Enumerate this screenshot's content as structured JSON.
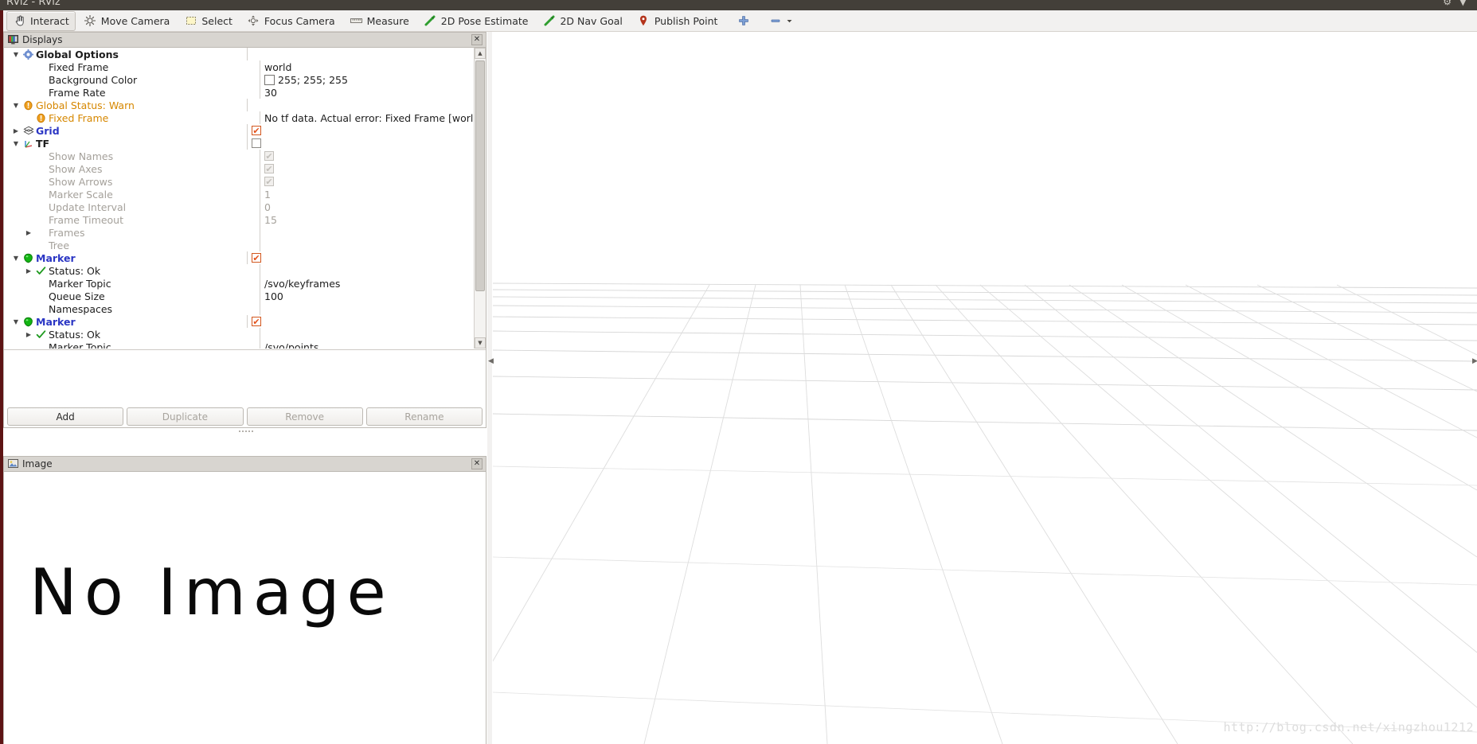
{
  "window": {
    "title": "RViz  -  RViz",
    "tray": "⚙  ▼"
  },
  "toolbar": {
    "items": [
      {
        "label": "Interact",
        "icon": "hand-cursor-icon",
        "active": true
      },
      {
        "label": "Move Camera",
        "icon": "move-camera-icon",
        "active": false
      },
      {
        "label": "Select",
        "icon": "selection-box-icon",
        "active": false
      },
      {
        "label": "Focus Camera",
        "icon": "focus-crosshair-icon",
        "active": false
      },
      {
        "label": "Measure",
        "icon": "ruler-icon",
        "active": false
      },
      {
        "label": "2D Pose Estimate",
        "icon": "green-arrow-icon",
        "active": false
      },
      {
        "label": "2D Nav Goal",
        "icon": "green-arrow-icon",
        "active": false
      },
      {
        "label": "Publish Point",
        "icon": "map-pin-icon",
        "active": false
      },
      {
        "label": "",
        "icon": "plus-icon",
        "active": false
      },
      {
        "label": "",
        "icon": "minus-dropdown-icon",
        "active": false
      }
    ]
  },
  "displays_panel": {
    "title": "Displays",
    "close_label": "✕",
    "rows": [
      {
        "indent": 0,
        "arrow": "down",
        "icon": "gear-icon",
        "label": "Global Options",
        "style": "bold",
        "value": "",
        "value_type": "text"
      },
      {
        "indent": 1,
        "arrow": "none",
        "icon": "none",
        "label": "Fixed Frame",
        "style": "plain",
        "value": "world",
        "value_type": "text"
      },
      {
        "indent": 1,
        "arrow": "none",
        "icon": "none",
        "label": "Background Color",
        "style": "plain",
        "value": "255; 255; 255",
        "value_type": "color",
        "swatch": "#ffffff"
      },
      {
        "indent": 1,
        "arrow": "none",
        "icon": "none",
        "label": "Frame Rate",
        "style": "plain",
        "value": "30",
        "value_type": "text"
      },
      {
        "indent": 0,
        "arrow": "down",
        "icon": "warn-icon",
        "label": "Global Status: Warn",
        "style": "warn",
        "value": "",
        "value_type": "text"
      },
      {
        "indent": 1,
        "arrow": "none",
        "icon": "warn-icon",
        "label": "Fixed Frame",
        "style": "warn",
        "value": "No tf data.  Actual error: Fixed Frame [world] doe…",
        "value_type": "text"
      },
      {
        "indent": 0,
        "arrow": "right",
        "icon": "grid-icon",
        "label": "Grid",
        "style": "blue",
        "value": "",
        "value_type": "checkbox",
        "checked": true
      },
      {
        "indent": 0,
        "arrow": "down",
        "icon": "tf-axes-icon",
        "label": "TF",
        "style": "bold",
        "value": "",
        "value_type": "checkbox",
        "checked": false
      },
      {
        "indent": 1,
        "arrow": "none",
        "icon": "none",
        "label": "Show Names",
        "style": "dim",
        "value": "",
        "value_type": "checkbox-disabled"
      },
      {
        "indent": 1,
        "arrow": "none",
        "icon": "none",
        "label": "Show Axes",
        "style": "dim",
        "value": "",
        "value_type": "checkbox-disabled"
      },
      {
        "indent": 1,
        "arrow": "none",
        "icon": "none",
        "label": "Show Arrows",
        "style": "dim",
        "value": "",
        "value_type": "checkbox-disabled"
      },
      {
        "indent": 1,
        "arrow": "none",
        "icon": "none",
        "label": "Marker Scale",
        "style": "dim",
        "value": "1",
        "value_type": "text-dim"
      },
      {
        "indent": 1,
        "arrow": "none",
        "icon": "none",
        "label": "Update Interval",
        "style": "dim",
        "value": "0",
        "value_type": "text-dim"
      },
      {
        "indent": 1,
        "arrow": "none",
        "icon": "none",
        "label": "Frame Timeout",
        "style": "dim",
        "value": "15",
        "value_type": "text-dim"
      },
      {
        "indent": 1,
        "arrow": "right",
        "icon": "none",
        "label": "Frames",
        "style": "dim",
        "value": "",
        "value_type": "text"
      },
      {
        "indent": 1,
        "arrow": "none",
        "icon": "none",
        "label": "Tree",
        "style": "dim",
        "value": "",
        "value_type": "text"
      },
      {
        "indent": 0,
        "arrow": "down",
        "icon": "marker-icon",
        "label": "Marker",
        "style": "blue",
        "value": "",
        "value_type": "checkbox",
        "checked": true
      },
      {
        "indent": 1,
        "arrow": "right",
        "icon": "ok-check-icon",
        "label": "Status: Ok",
        "style": "plain",
        "value": "",
        "value_type": "text"
      },
      {
        "indent": 1,
        "arrow": "none",
        "icon": "none",
        "label": "Marker Topic",
        "style": "plain",
        "value": "/svo/keyframes",
        "value_type": "text"
      },
      {
        "indent": 1,
        "arrow": "none",
        "icon": "none",
        "label": "Queue Size",
        "style": "plain",
        "value": "100",
        "value_type": "text"
      },
      {
        "indent": 1,
        "arrow": "none",
        "icon": "none",
        "label": "Namespaces",
        "style": "plain",
        "value": "",
        "value_type": "text"
      },
      {
        "indent": 0,
        "arrow": "down",
        "icon": "marker-icon",
        "label": "Marker",
        "style": "blue",
        "value": "",
        "value_type": "checkbox",
        "checked": true
      },
      {
        "indent": 1,
        "arrow": "right",
        "icon": "ok-check-icon",
        "label": "Status: Ok",
        "style": "plain",
        "value": "",
        "value_type": "text"
      },
      {
        "indent": 1,
        "arrow": "none",
        "icon": "none",
        "label": "Marker Topic",
        "style": "plain",
        "value": "/svo/points",
        "value_type": "text"
      }
    ],
    "buttons": [
      {
        "label": "Add",
        "disabled": false
      },
      {
        "label": "Duplicate",
        "disabled": true
      },
      {
        "label": "Remove",
        "disabled": true
      },
      {
        "label": "Rename",
        "disabled": true
      }
    ]
  },
  "image_panel": {
    "title": "Image",
    "close_label": "✕",
    "placeholder": "No Image"
  },
  "render_view": {
    "watermark": "http://blog.csdn.net/xingzhou1212",
    "background": "#ffffff",
    "grid_color": "#d5d5d5"
  }
}
